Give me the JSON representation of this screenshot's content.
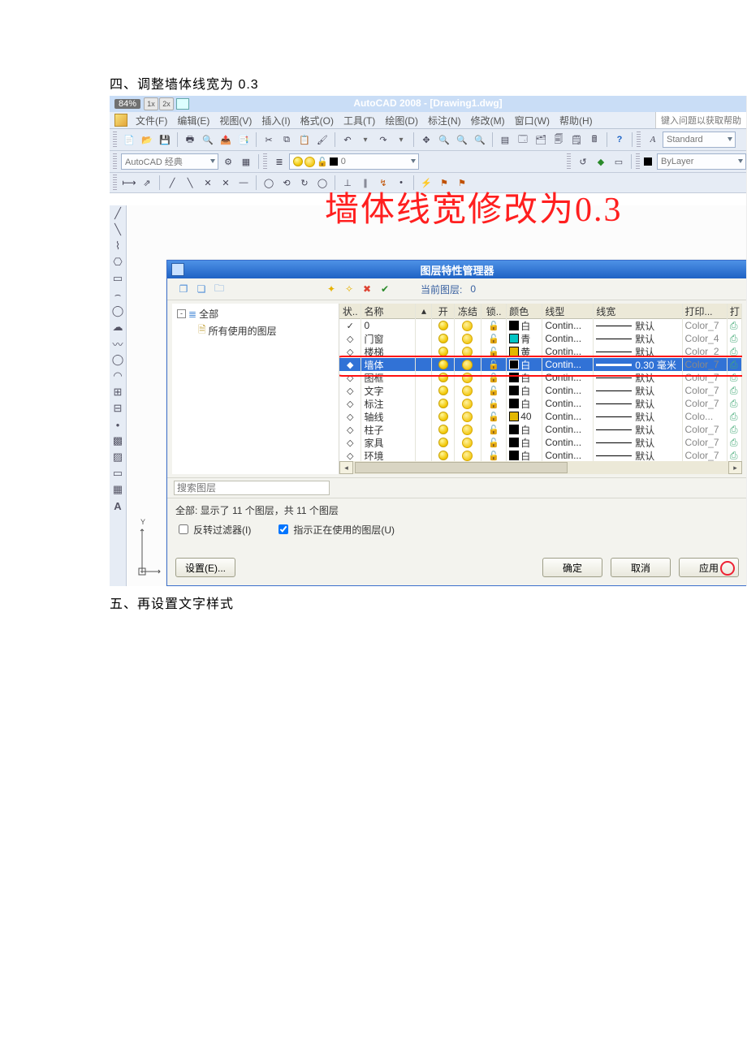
{
  "doc": {
    "heading4": "四、调整墙体线宽为 0.3",
    "heading5": "五、再设置文字样式"
  },
  "annotation": {
    "red_text": "墙体线宽修改为0.3"
  },
  "titlebar": {
    "zoom": "84%",
    "chip1": "1x",
    "chip2": "2x",
    "app_title": "AutoCAD 2008 - [Drawing1.dwg]"
  },
  "menu": {
    "file": "文件(F)",
    "edit": "编辑(E)",
    "view": "视图(V)",
    "insert": "插入(I)",
    "format": "格式(O)",
    "tools": "工具(T)",
    "draw": "绘图(D)",
    "dimension": "标注(N)",
    "modify": "修改(M)",
    "window": "窗口(W)",
    "help": "帮助(H)",
    "help_hint": "键入问题以获取帮助"
  },
  "toolbar": {
    "workspace": "AutoCAD 经典",
    "style": "Standard",
    "bylayer": "ByLayer",
    "layer_current": "0"
  },
  "dialog": {
    "title": "图层特性管理器",
    "current_layer_label": "当前图层:",
    "current_layer_value": "0",
    "tree_root": "全部",
    "tree_child": "所有使用的图层",
    "headers": {
      "status": "状..",
      "name": "名称",
      "on": "开",
      "freeze": "冻结",
      "lock": "锁..",
      "color": "颜色",
      "linetype": "线型",
      "lineweight": "线宽",
      "plotstyle": "打印...",
      "plot": "打"
    },
    "rows": [
      {
        "status": "✓",
        "name": "0",
        "color": "白",
        "swatch": "sw-black",
        "lt": "Contin...",
        "lw": "默认",
        "lwthick": false,
        "plotstyle": "Color_7"
      },
      {
        "status": "◇",
        "name": "门窗",
        "color": "青",
        "swatch": "sw-cyan",
        "lt": "Contin...",
        "lw": "默认",
        "lwthick": false,
        "plotstyle": "Color_4"
      },
      {
        "status": "◇",
        "name": "楼梯",
        "color": "黄",
        "swatch": "sw-y",
        "lt": "Contin...",
        "lw": "默认",
        "lwthick": false,
        "plotstyle": "Color_2"
      },
      {
        "status": "◆",
        "name": "墙体",
        "color": "白",
        "swatch": "sw-black",
        "lt": "Contin...",
        "lw": "0.30 毫米",
        "lwthick": true,
        "plotstyle": "Color_7",
        "selected": true
      },
      {
        "status": "◇",
        "name": "图框",
        "color": "白",
        "swatch": "sw-black",
        "lt": "Contin...",
        "lw": "默认",
        "lwthick": false,
        "plotstyle": "Color_7"
      },
      {
        "status": "◇",
        "name": "文字",
        "color": "白",
        "swatch": "sw-black",
        "lt": "Contin...",
        "lw": "默认",
        "lwthick": false,
        "plotstyle": "Color_7"
      },
      {
        "status": "◇",
        "name": "标注",
        "color": "白",
        "swatch": "sw-black",
        "lt": "Contin...",
        "lw": "默认",
        "lwthick": false,
        "plotstyle": "Color_7"
      },
      {
        "status": "◇",
        "name": "轴线",
        "color": "40",
        "swatch": "sw-y",
        "lt": "Contin...",
        "lw": "默认",
        "lwthick": false,
        "plotstyle": "Colo..."
      },
      {
        "status": "◇",
        "name": "柱子",
        "color": "白",
        "swatch": "sw-black",
        "lt": "Contin...",
        "lw": "默认",
        "lwthick": false,
        "plotstyle": "Color_7"
      },
      {
        "status": "◇",
        "name": "家具",
        "color": "白",
        "swatch": "sw-black",
        "lt": "Contin...",
        "lw": "默认",
        "lwthick": false,
        "plotstyle": "Color_7"
      },
      {
        "status": "◇",
        "name": "环境",
        "color": "白",
        "swatch": "sw-black",
        "lt": "Contin...",
        "lw": "默认",
        "lwthick": false,
        "plotstyle": "Color_7"
      }
    ],
    "search_placeholder": "搜索图层",
    "summary": "全部: 显示了 11 个图层，共 11 个图层",
    "invert_filter": "反转过滤器(I)",
    "indicate_in_use": "指示正在使用的图层(U)",
    "btn_settings": "设置(E)...",
    "btn_ok": "确定",
    "btn_cancel": "取消",
    "btn_apply": "应用"
  }
}
